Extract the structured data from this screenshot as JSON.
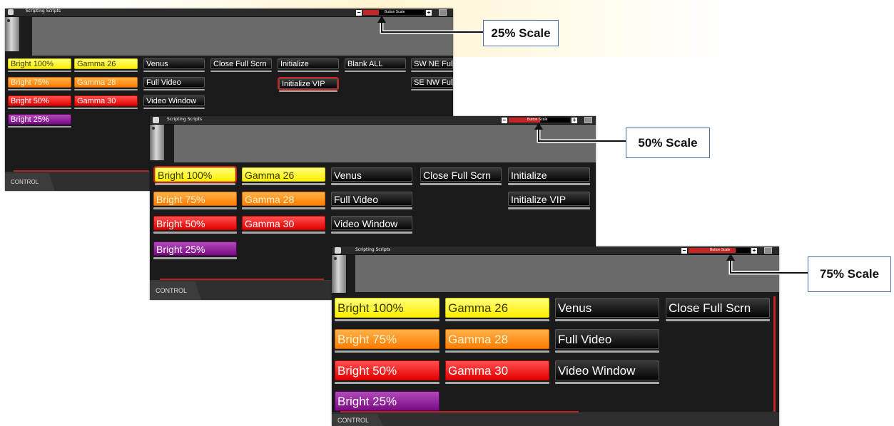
{
  "windows": [
    {
      "id": "w25",
      "title": "Scripting Scripts",
      "scale_label": "Button Scale",
      "tab_label": "CONTROL",
      "buttons": {
        "bright100": "Bright 100%",
        "bright75": "Bright 75%",
        "bright50": "Bright 50%",
        "bright25": "Bright 25%",
        "gamma26": "Gamma 26",
        "gamma28": "Gamma 28",
        "gamma30": "Gamma 30",
        "venus": "Venus",
        "full_video": "Full Video",
        "video_window": "Video Window",
        "close_full_scrn": "Close Full Scrn",
        "initialize": "Initialize",
        "initialize_vip": "Initialize VIP",
        "blank_all": "Blank ALL",
        "sw_ne": "SW NE Full V",
        "se_nw": "SE NW Full V"
      }
    },
    {
      "id": "w50",
      "title": "Scripting Scripts",
      "scale_label": "Button Scale",
      "tab_label": "CONTROL",
      "buttons": {
        "bright100": "Bright 100%",
        "bright75": "Bright 75%",
        "bright50": "Bright 50%",
        "bright25": "Bright 25%",
        "gamma26": "Gamma 26",
        "gamma28": "Gamma 28",
        "gamma30": "Gamma 30",
        "venus": "Venus",
        "full_video": "Full Video",
        "video_window": "Video Window",
        "close_full_scrn": "Close Full Scrn",
        "initialize": "Initialize",
        "initialize_vip": "Initialize VIP"
      }
    },
    {
      "id": "w75",
      "title": "Scripting Scripts",
      "scale_label": "Button Scale",
      "tab_label": "CONTROL",
      "buttons": {
        "bright100": "Bright 100%",
        "bright75": "Bright 75%",
        "bright50": "Bright 50%",
        "bright25": "Bright 25%",
        "gamma26": "Gamma 26",
        "gamma28": "Gamma 28",
        "gamma30": "Gamma 30",
        "venus": "Venus",
        "full_video": "Full Video",
        "video_window": "Video Window",
        "close_full_scrn": "Close Full Scrn"
      }
    }
  ],
  "callouts": [
    "25% Scale",
    "50% Scale",
    "75% Scale"
  ],
  "colors": {
    "yellow": "#ffef00",
    "orange": "#ff7c00",
    "red": "#e30000",
    "purple": "#7a0a85",
    "black": "#050505",
    "accent_red": "#c42424"
  }
}
